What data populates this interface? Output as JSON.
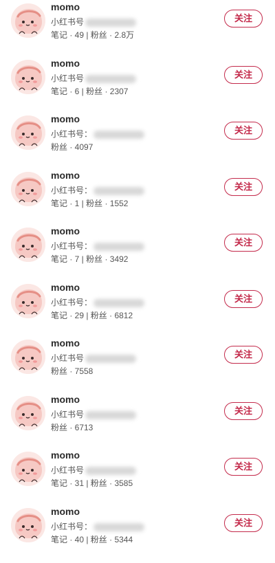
{
  "users": [
    {
      "name": "momo",
      "id_label": "小红书号",
      "stats": "笔记 · 49 | 粉丝 · 2.8万",
      "follow_label": "关注",
      "avatar": "pink-blob-avatar"
    },
    {
      "name": "momo",
      "id_label": "小红书号",
      "stats": "笔记 · 6 | 粉丝 · 2307",
      "follow_label": "关注",
      "avatar": "pink-blob-avatar"
    },
    {
      "name": "momo",
      "id_label": "小红书号：",
      "stats": "粉丝 · 4097",
      "follow_label": "关注",
      "avatar": "pink-blob-avatar"
    },
    {
      "name": "momo",
      "id_label": "小红书号：",
      "stats": "笔记 · 1 | 粉丝 · 1552",
      "follow_label": "关注",
      "avatar": "pink-blob-avatar"
    },
    {
      "name": "momo",
      "id_label": "小红书号：",
      "stats": "笔记 · 7 | 粉丝 · 3492",
      "follow_label": "关注",
      "avatar": "pink-blob-avatar"
    },
    {
      "name": "momo",
      "id_label": "小红书号：",
      "stats": "笔记 · 29 | 粉丝 · 6812",
      "follow_label": "关注",
      "avatar": "pink-blob-avatar"
    },
    {
      "name": "momo",
      "id_label": "小红书号",
      "stats": "粉丝 · 7558",
      "follow_label": "关注",
      "avatar": "pink-blob-avatar"
    },
    {
      "name": "momo",
      "id_label": "小红书号",
      "stats": "粉丝 · 6713",
      "follow_label": "关注",
      "avatar": "pink-blob-avatar"
    },
    {
      "name": "momo",
      "id_label": "小红书号",
      "stats": "笔记 · 31 | 粉丝 · 3585",
      "follow_label": "关注",
      "avatar": "pink-blob-avatar"
    },
    {
      "name": "momo",
      "id_label": "小红书号：",
      "stats": "笔记 · 40 | 粉丝 · 5344",
      "follow_label": "关注",
      "avatar": "pink-blob-avatar"
    }
  ],
  "colors": {
    "accent": "#c3294a",
    "avatar_bg": "#fbe7e4",
    "avatar_blob": "#f6c9c4"
  }
}
